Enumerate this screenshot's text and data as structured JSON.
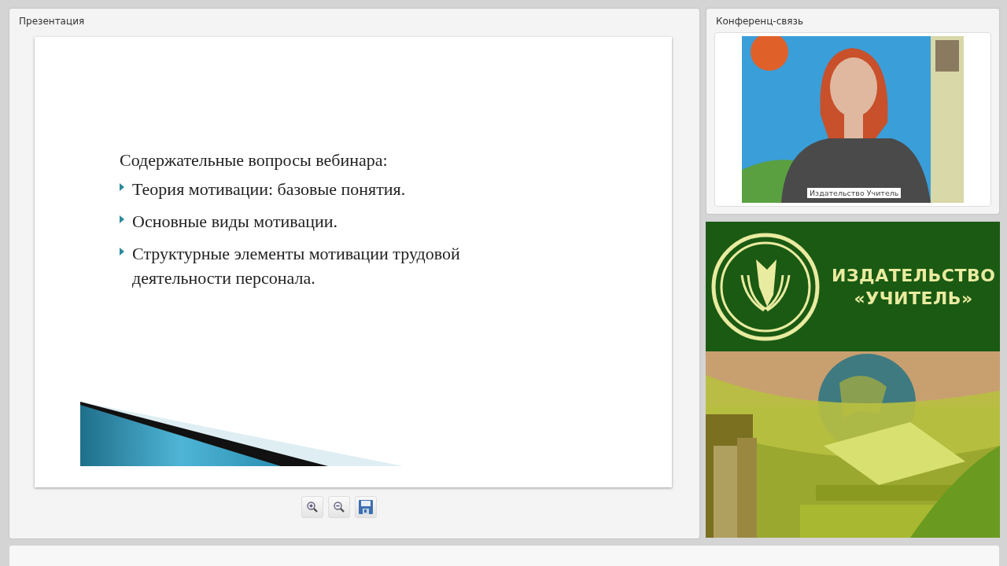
{
  "presentation": {
    "title": "Презентация",
    "slide": {
      "heading": "Содержательные вопросы вебинара:",
      "bullets": [
        "Теория мотивации: базовые понятия.",
        "Основные виды мотивации.",
        "Структурные элементы мотивации трудовой деятельности персонала."
      ]
    },
    "toolbar": [
      {
        "kind": "zoom-in"
      },
      {
        "kind": "zoom-out"
      },
      {
        "kind": "save"
      }
    ]
  },
  "conference": {
    "title": "Конференц-связь",
    "video": {
      "kind": "picture",
      "caption": "Издательство Учитель"
    }
  },
  "banner": {
    "line_1": "ИЗДАТЕЛЬСТВО",
    "line_2": "«УЧИТЕЛЬ»"
  }
}
